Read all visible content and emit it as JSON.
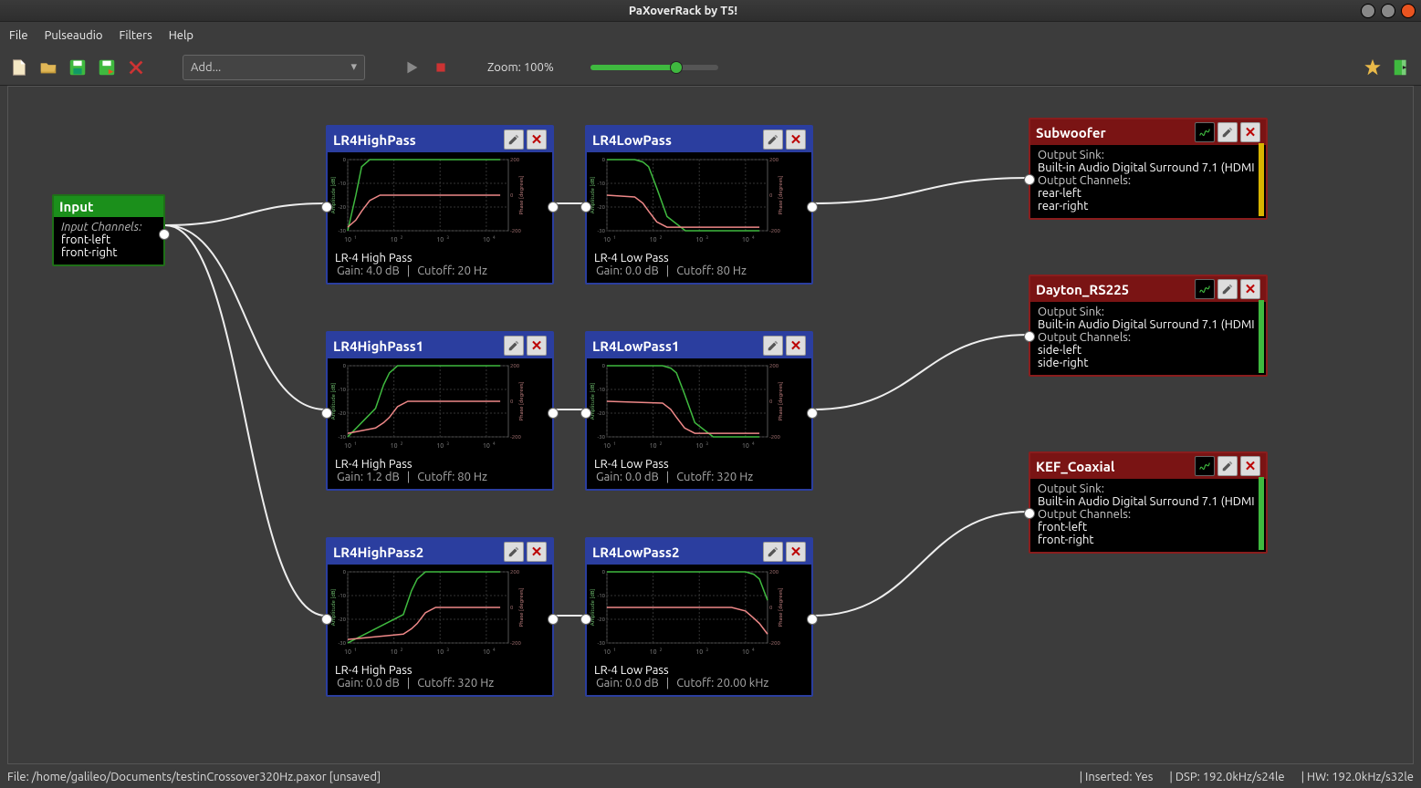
{
  "window": {
    "title": "PaXoverRack by T5!"
  },
  "menu": {
    "file": "File",
    "pulseaudio": "Pulseaudio",
    "filters": "Filters",
    "help": "Help"
  },
  "toolbar": {
    "add_placeholder": "Add...",
    "zoom_label": "Zoom: 100%"
  },
  "input_node": {
    "title": "Input",
    "channels_label": "Input Channels:",
    "ch1": "front-left",
    "ch2": "front-right"
  },
  "filters": {
    "hp0": {
      "title": "LR4HighPass",
      "name": "LR-4 High Pass",
      "gain": "Gain: 4.0 dB",
      "cutoff": "Cutoff:  20 Hz"
    },
    "lp0": {
      "title": "LR4LowPass",
      "name": "LR-4 Low Pass",
      "gain": "Gain: 0.0 dB",
      "cutoff": "Cutoff:  80 Hz"
    },
    "hp1": {
      "title": "LR4HighPass1",
      "name": "LR-4 High Pass",
      "gain": "Gain: 1.2 dB",
      "cutoff": "Cutoff:  80 Hz"
    },
    "lp1": {
      "title": "LR4LowPass1",
      "name": "LR-4 Low Pass",
      "gain": "Gain: 0.0 dB",
      "cutoff": "Cutoff:  320 Hz"
    },
    "hp2": {
      "title": "LR4HighPass2",
      "name": "LR-4 High Pass",
      "gain": "Gain: 0.0 dB",
      "cutoff": "Cutoff:  320 Hz"
    },
    "lp2": {
      "title": "LR4LowPass2",
      "name": "LR-4 Low Pass",
      "gain": "Gain: 0.0 dB",
      "cutoff": "Cutoff:  20.00 kHz"
    }
  },
  "outputs": {
    "sub": {
      "title": "Subwoofer",
      "sink_label": "Output Sink:",
      "sink": "Built-in Audio Digital Surround 7.1 (HDMI",
      "ch_label": "Output Channels:",
      "ch1": "rear-left",
      "ch2": "rear-right"
    },
    "dayton": {
      "title": "Dayton_RS225",
      "sink_label": "Output Sink:",
      "sink": "Built-in Audio Digital Surround 7.1 (HDMI",
      "ch_label": "Output Channels:",
      "ch1": "side-left",
      "ch2": "side-right"
    },
    "kef": {
      "title": "KEF_Coaxial",
      "sink_label": "Output Sink:",
      "sink": "Built-in Audio Digital Surround 7.1 (HDMI",
      "ch_label": "Output Channels:",
      "ch1": "front-left",
      "ch2": "front-right"
    }
  },
  "status": {
    "file": "File: /home/galileo/Documents/testinCrossover320Hz.paxor [unsaved]",
    "inserted": "| Inserted:  Yes",
    "dsp": "|  DSP:  192.0kHz/s24le",
    "hw": "|  HW:  192.0kHz/s32le"
  },
  "chart_data": [
    {
      "name": "LR4HighPass",
      "type": "line",
      "xscale": "log",
      "xlabel": "",
      "ylabel_left": "Amplitude [dB]",
      "ylabel_right": "Phase [degrees]",
      "x_ticks": [
        "10^1",
        "10^2",
        "10^3",
        "10^4"
      ],
      "amp_ticks": [
        0,
        -10,
        -20,
        -30
      ],
      "phase_ticks": [
        200,
        0,
        -200
      ],
      "ylim_amp": [
        -30,
        0
      ],
      "ylim_phase": [
        -200,
        200
      ],
      "series": [
        {
          "name": "amplitude",
          "color": "#3fb93f",
          "x": [
            10,
            15,
            20,
            30,
            50,
            100,
            1000,
            20000
          ],
          "y": [
            -30,
            -15,
            -3,
            0,
            0,
            0,
            0,
            0
          ]
        },
        {
          "name": "phase",
          "color": "#e88",
          "x": [
            10,
            15,
            20,
            30,
            50,
            100,
            1000,
            20000
          ],
          "y": [
            -180,
            -140,
            -90,
            -30,
            0,
            0,
            0,
            0
          ]
        }
      ]
    },
    {
      "name": "LR4LowPass",
      "type": "line",
      "xscale": "log",
      "xlabel": "",
      "ylabel_left": "Amplitude [dB]",
      "ylabel_right": "Phase [degrees]",
      "x_ticks": [
        "10^1",
        "10^2",
        "10^3",
        "10^4"
      ],
      "amp_ticks": [
        0,
        -10,
        -20,
        -30
      ],
      "phase_ticks": [
        200,
        0,
        -200
      ],
      "ylim_amp": [
        -30,
        0
      ],
      "ylim_phase": [
        -200,
        200
      ],
      "series": [
        {
          "name": "amplitude",
          "color": "#3fb93f",
          "x": [
            10,
            40,
            60,
            80,
            120,
            200,
            500,
            20000
          ],
          "y": [
            0,
            0,
            -1,
            -3,
            -12,
            -24,
            -30,
            -30
          ]
        },
        {
          "name": "phase",
          "color": "#e88",
          "x": [
            10,
            40,
            60,
            80,
            120,
            200,
            500,
            20000
          ],
          "y": [
            0,
            -10,
            -45,
            -90,
            -150,
            -180,
            -180,
            -180
          ]
        }
      ]
    },
    {
      "name": "LR4HighPass1",
      "type": "line",
      "xscale": "log",
      "xlabel": "",
      "ylabel_left": "Amplitude [dB]",
      "ylabel_right": "Phase [degrees]",
      "x_ticks": [
        "10^1",
        "10^2",
        "10^3",
        "10^4"
      ],
      "amp_ticks": [
        0,
        -10,
        -20,
        -30
      ],
      "phase_ticks": [
        200,
        0,
        -200
      ],
      "ylim_amp": [
        -30,
        0
      ],
      "ylim_phase": [
        -200,
        200
      ],
      "series": [
        {
          "name": "amplitude",
          "color": "#3fb93f",
          "x": [
            10,
            40,
            60,
            80,
            120,
            200,
            500,
            20000
          ],
          "y": [
            -30,
            -18,
            -8,
            -3,
            0,
            0,
            0,
            0
          ]
        },
        {
          "name": "phase",
          "color": "#e88",
          "x": [
            10,
            40,
            60,
            80,
            120,
            200,
            500,
            20000
          ],
          "y": [
            -180,
            -150,
            -120,
            -90,
            -30,
            0,
            0,
            0
          ]
        }
      ]
    },
    {
      "name": "LR4LowPass1",
      "type": "line",
      "xscale": "log",
      "xlabel": "",
      "ylabel_left": "Amplitude [dB]",
      "ylabel_right": "Phase [degrees]",
      "x_ticks": [
        "10^1",
        "10^2",
        "10^3",
        "10^4"
      ],
      "amp_ticks": [
        0,
        -10,
        -20,
        -30
      ],
      "phase_ticks": [
        200,
        0,
        -200
      ],
      "ylim_amp": [
        -30,
        0
      ],
      "ylim_phase": [
        -200,
        200
      ],
      "series": [
        {
          "name": "amplitude",
          "color": "#3fb93f",
          "x": [
            10,
            160,
            240,
            320,
            480,
            800,
            2000,
            20000
          ],
          "y": [
            0,
            0,
            -1,
            -3,
            -12,
            -24,
            -30,
            -30
          ]
        },
        {
          "name": "phase",
          "color": "#e88",
          "x": [
            10,
            160,
            240,
            320,
            480,
            800,
            2000,
            20000
          ],
          "y": [
            0,
            -10,
            -45,
            -90,
            -150,
            -180,
            -180,
            -180
          ]
        }
      ]
    },
    {
      "name": "LR4HighPass2",
      "type": "line",
      "xscale": "log",
      "xlabel": "",
      "ylabel_left": "Amplitude [dB]",
      "ylabel_right": "Phase [degrees]",
      "x_ticks": [
        "10^1",
        "10^2",
        "10^3",
        "10^4"
      ],
      "amp_ticks": [
        0,
        -10,
        -20,
        -30
      ],
      "phase_ticks": [
        200,
        0,
        -200
      ],
      "ylim_amp": [
        -30,
        0
      ],
      "ylim_phase": [
        -200,
        200
      ],
      "series": [
        {
          "name": "amplitude",
          "color": "#3fb93f",
          "x": [
            10,
            160,
            240,
            320,
            480,
            800,
            2000,
            20000
          ],
          "y": [
            -30,
            -18,
            -8,
            -3,
            0,
            0,
            0,
            0
          ]
        },
        {
          "name": "phase",
          "color": "#e88",
          "x": [
            10,
            160,
            240,
            320,
            480,
            800,
            2000,
            20000
          ],
          "y": [
            -180,
            -150,
            -120,
            -90,
            -30,
            0,
            0,
            0
          ]
        }
      ]
    },
    {
      "name": "LR4LowPass2",
      "type": "line",
      "xscale": "log",
      "xlabel": "",
      "ylabel_left": "Amplitude [dB]",
      "ylabel_right": "Phase [degrees]",
      "x_ticks": [
        "10^1",
        "10^2",
        "10^3",
        "10^4"
      ],
      "amp_ticks": [
        0,
        -10,
        -20,
        -30
      ],
      "phase_ticks": [
        200,
        0,
        -200
      ],
      "ylim_amp": [
        -30,
        0
      ],
      "ylim_phase": [
        -200,
        200
      ],
      "series": [
        {
          "name": "amplitude",
          "color": "#3fb93f",
          "x": [
            10,
            5000,
            10000,
            15000,
            20000,
            30000
          ],
          "y": [
            0,
            0,
            0,
            -1,
            -3,
            -12
          ]
        },
        {
          "name": "phase",
          "color": "#e88",
          "x": [
            10,
            5000,
            10000,
            15000,
            20000,
            30000
          ],
          "y": [
            0,
            0,
            -20,
            -60,
            -90,
            -150
          ]
        }
      ]
    }
  ]
}
